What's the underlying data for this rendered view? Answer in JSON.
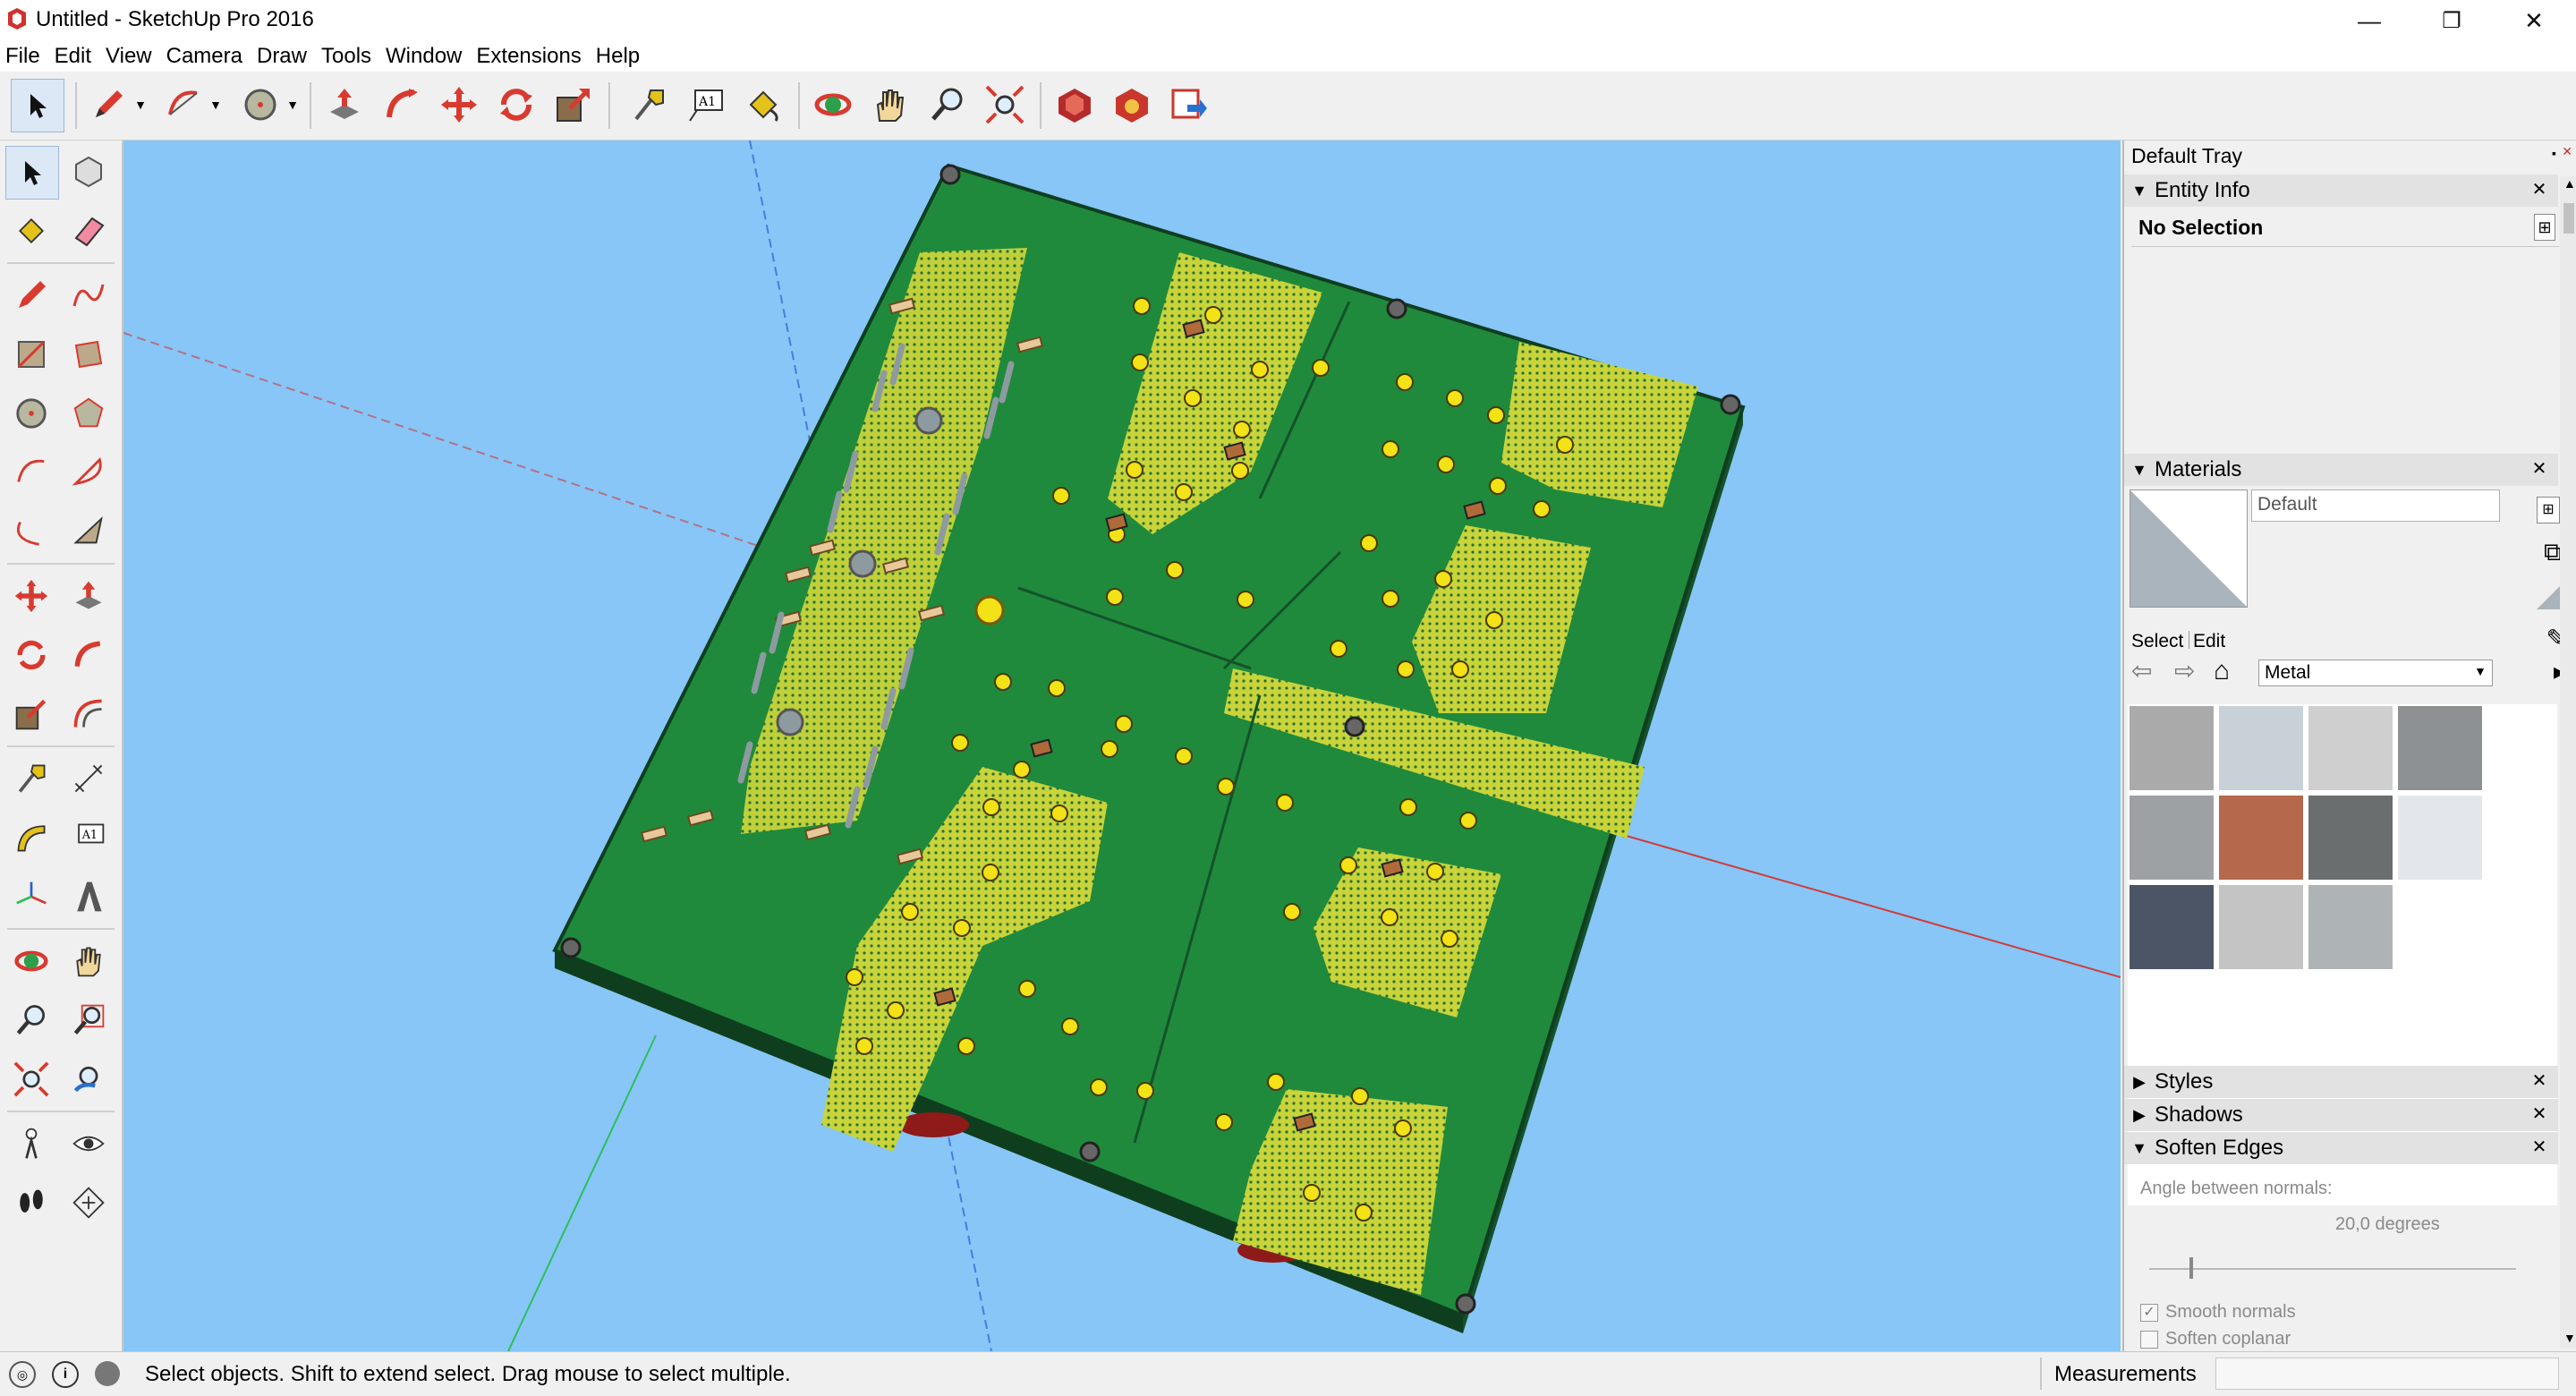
{
  "window": {
    "title": "Untitled - SketchUp Pro 2016",
    "minimize": "—",
    "restore": "❐",
    "close": "✕"
  },
  "menu": [
    "File",
    "Edit",
    "View",
    "Camera",
    "Draw",
    "Tools",
    "Window",
    "Extensions",
    "Help"
  ],
  "toolbar_icons": [
    "select-icon",
    "pencil-icon",
    "arc-icon",
    "circle-icon",
    "push-pull-icon",
    "follow-me-icon",
    "move-icon",
    "rotate-icon",
    "scale-icon",
    "tape-measure-icon",
    "text-icon",
    "paint-bucket-icon",
    "orbit-icon",
    "pan-icon",
    "zoom-icon",
    "zoom-extents-icon",
    "warehouse-icon",
    "extension-warehouse-icon",
    "send-to-layout-icon"
  ],
  "left_tools": [
    "select-icon",
    "component-icon",
    "paint-bucket-icon",
    "eraser-icon",
    "pencil-icon",
    "freehand-icon",
    "rectangle-icon",
    "rotated-rectangle-icon",
    "circle-icon",
    "polygon-icon",
    "arc-icon",
    "pie-icon",
    "two-point-arc-icon",
    "three-point-arc-icon",
    "move-icon",
    "push-pull-icon",
    "rotate-icon",
    "follow-me-icon",
    "scale-icon",
    "offset-icon",
    "tape-measure-icon",
    "dimension-icon",
    "protractor-icon",
    "text-icon",
    "axes-icon",
    "3d-text-icon",
    "orbit-icon",
    "pan-icon",
    "zoom-icon",
    "zoom-window-icon",
    "zoom-extents-icon",
    "previous-view-icon",
    "position-camera-icon",
    "look-around-icon",
    "walk-icon",
    "section-plane-icon"
  ],
  "tray": {
    "title": "Default Tray",
    "entity_info": {
      "label": "Entity Info",
      "selection": "No Selection"
    },
    "materials": {
      "label": "Materials",
      "current_name": "Default",
      "tab_select": "Select",
      "tab_edit": "Edit",
      "library": "Metal",
      "swatch_colors": [
        "#a9aaa9",
        "#c8d0d8",
        "#cfcfcf",
        "#8e9193",
        "#9ea1a3",
        "#b5684c",
        "#6b6e6e",
        "#e3e6ea",
        "#4c5566",
        "#c4c4c4",
        "#aeb3b5"
      ]
    },
    "styles": {
      "label": "Styles"
    },
    "shadows": {
      "label": "Shadows"
    },
    "soften_edges": {
      "label": "Soften Edges",
      "angle_label": "Angle between normals:",
      "angle_value": "20,0  degrees",
      "angle_fraction": 0.11,
      "smooth_normals": "Smooth normals",
      "smooth_checked": true,
      "soften_coplanar": "Soften coplanar",
      "coplanar_checked": false
    }
  },
  "status": {
    "text": "Select objects. Shift to extend select. Drag mouse to select multiple.",
    "measurements_label": "Measurements",
    "measurements_value": ""
  },
  "colors": {
    "viewport_sky": "#87c6f7",
    "pcb_green": "#1f8a3c",
    "pcb_edge": "#0f3e1f",
    "copper_pour": "#c8d43a",
    "pad_yellow": "#f2e216",
    "axis_red": "#d23a3a",
    "axis_green": "#2dbf5a",
    "axis_blue": "#2b5fd1"
  }
}
